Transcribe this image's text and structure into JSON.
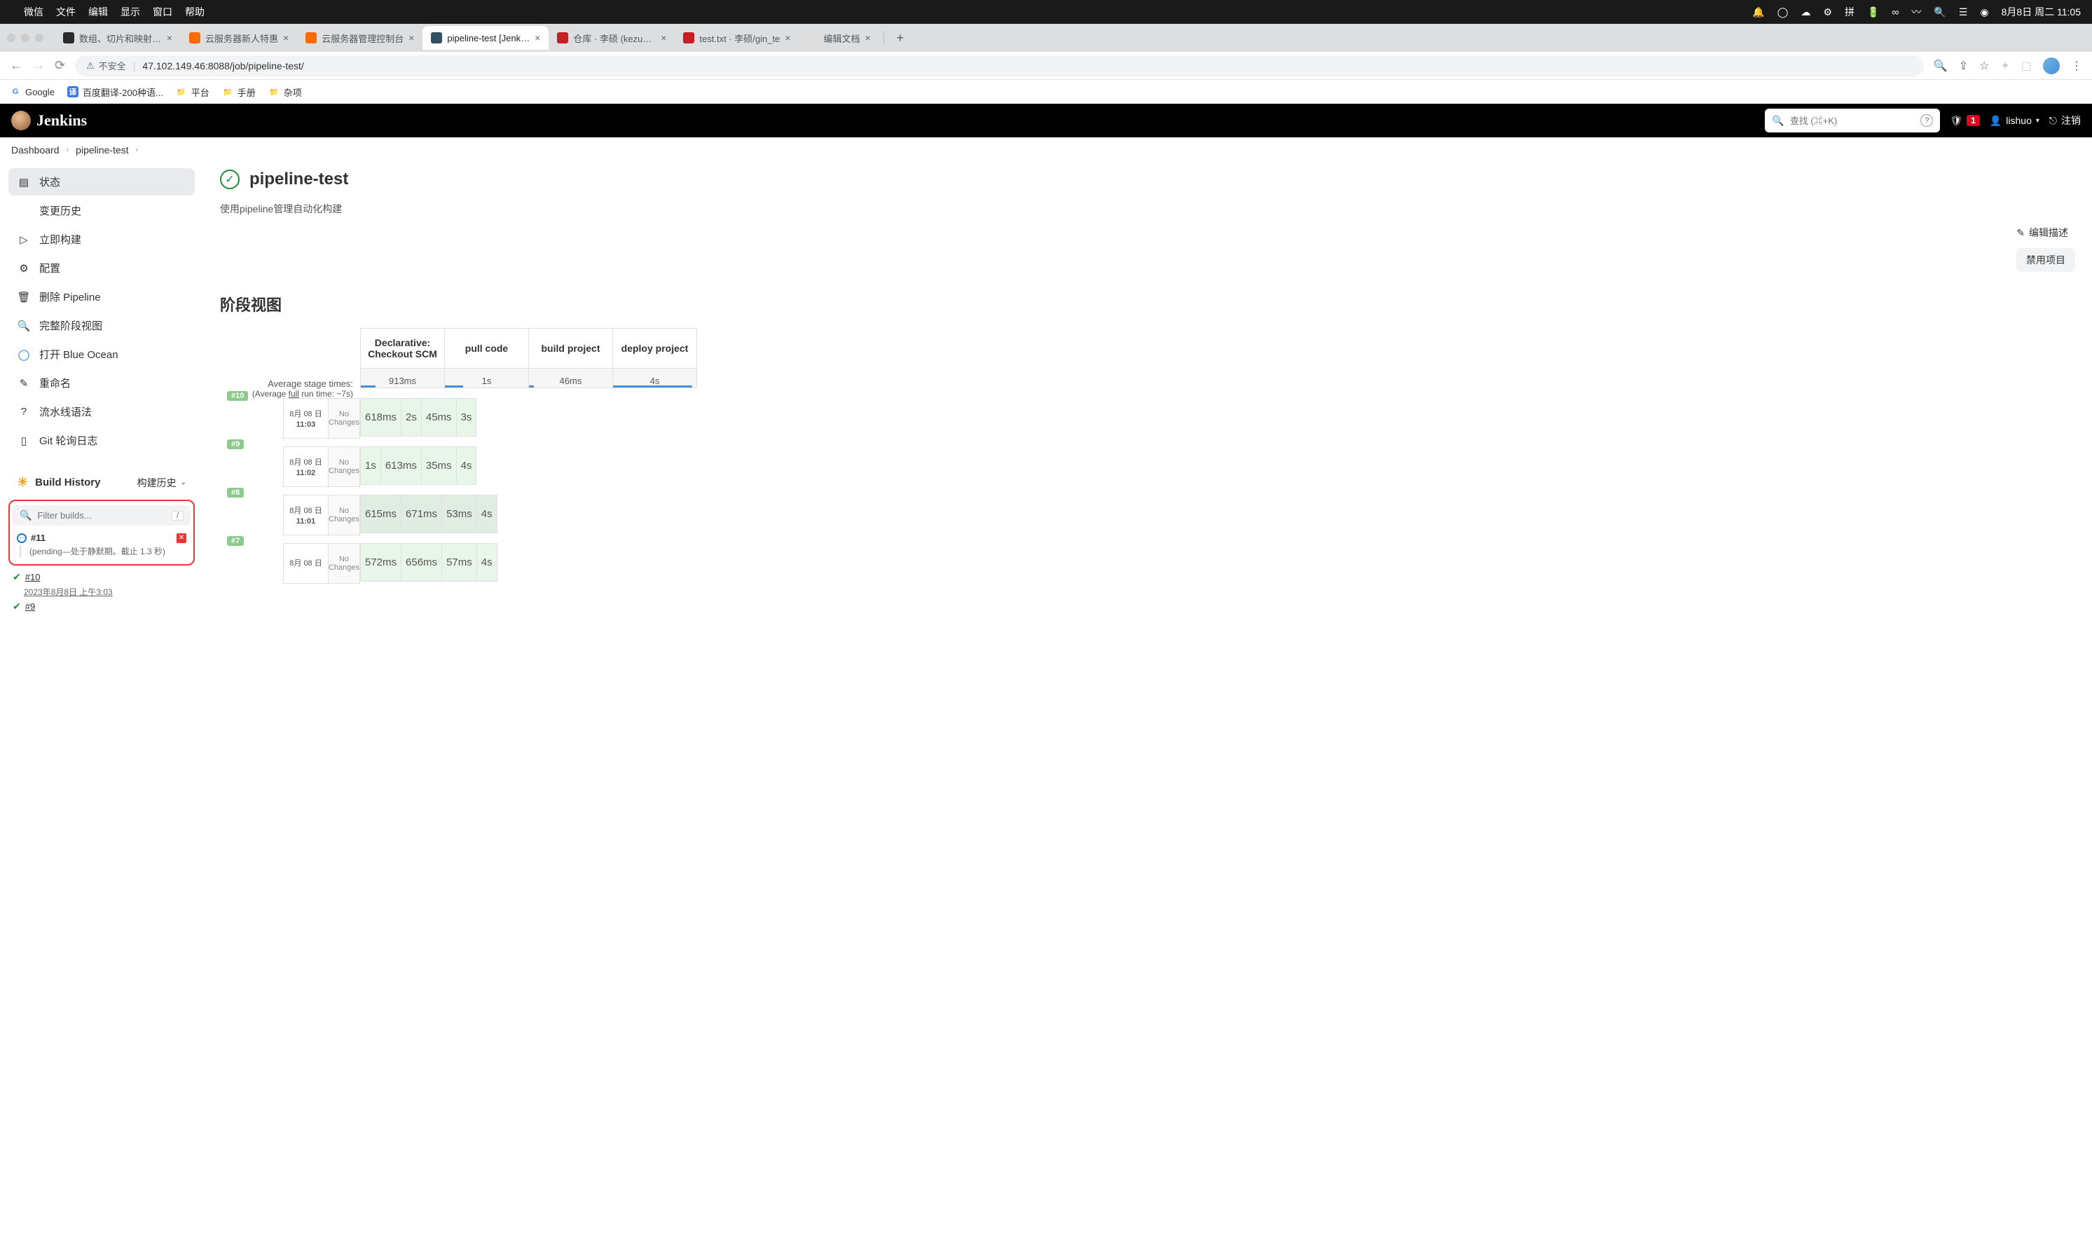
{
  "mac_menubar": {
    "app": "微信",
    "menus": [
      "文件",
      "编辑",
      "显示",
      "窗口",
      "帮助"
    ],
    "datetime": "8月8日 周二  11:05"
  },
  "browser": {
    "tabs": [
      {
        "label": "数组、切片和映射 -Go",
        "favicon_bg": "#2b2b2b"
      },
      {
        "label": "云服务器新人特惠",
        "favicon_bg": "#ff6a00"
      },
      {
        "label": "云服务器管理控制台",
        "favicon_bg": "#ff6a00"
      },
      {
        "label": "pipeline-test [Jenkins",
        "favicon_bg": "#335061",
        "active": true
      },
      {
        "label": "仓库 · 李硕 (kezuo) ·",
        "favicon_bg": "#c71d23"
      },
      {
        "label": "test.txt · 李硕/gin_te",
        "favicon_bg": "#c71d23"
      },
      {
        "label": "编辑文档",
        "favicon_bg": "#dddddd"
      }
    ],
    "address": {
      "insecure_label": "不安全",
      "url": "47.102.149.46:8088/job/pipeline-test/"
    },
    "bookmarks": [
      {
        "label": "Google",
        "icon": "G",
        "icon_bg": "#fff",
        "icon_color": "#4285f4"
      },
      {
        "label": "百度翻译-200种语...",
        "icon": "译",
        "icon_bg": "#3b7ae0",
        "icon_color": "#fff"
      },
      {
        "label": "平台",
        "icon": "📁"
      },
      {
        "label": "手册",
        "icon": "📁"
      },
      {
        "label": "杂项",
        "icon": "📁"
      }
    ]
  },
  "jenkins": {
    "logo": "Jenkins",
    "search_placeholder": "查找 (⌘+K)",
    "alert_count": "1",
    "user": "lishuo",
    "logout": "注销",
    "breadcrumb": [
      "Dashboard",
      "pipeline-test"
    ],
    "sidebar": [
      {
        "icon": "status",
        "label": "状态",
        "active": true
      },
      {
        "icon": "changes",
        "label": "变更历史"
      },
      {
        "icon": "build",
        "label": "立即构建"
      },
      {
        "icon": "config",
        "label": "配置"
      },
      {
        "icon": "delete",
        "label": "删除 Pipeline"
      },
      {
        "icon": "fullstage",
        "label": "完整阶段视图"
      },
      {
        "icon": "blueocean",
        "label": "打开 Blue Ocean"
      },
      {
        "icon": "rename",
        "label": "重命名"
      },
      {
        "icon": "syntax",
        "label": "流水线语法"
      },
      {
        "icon": "gitpoll",
        "label": "Git 轮询日志"
      }
    ],
    "build_history": {
      "title": "Build History",
      "subtitle": "构建历史",
      "filter_placeholder": "Filter builds...",
      "filter_kbd": "/",
      "pending": {
        "num": "#11",
        "text": "(pending—处于静默期。截止 1.3 秒)"
      },
      "builds": [
        {
          "num": "#10",
          "date": "2023年8月8日 上午3:03"
        },
        {
          "num": "#9"
        }
      ]
    },
    "page": {
      "title": "pipeline-test",
      "description": "使用pipeline管理自动化构建",
      "edit_desc": "编辑描述",
      "disable": "禁用项目",
      "section": "阶段视图",
      "stages": {
        "headers": [
          "Declarative: Checkout SCM",
          "pull code",
          "build project",
          "deploy project"
        ],
        "avg_label": "Average stage times:",
        "avg_sub_prefix": "(Average ",
        "avg_sub_link": "full",
        "avg_sub_suffix": " run time: ~7s)",
        "avg": [
          "913ms",
          "1s",
          "46ms",
          "4s"
        ],
        "avg_bar_pct": [
          18,
          22,
          6,
          95
        ],
        "rows": [
          {
            "badge": "#10",
            "date1": "8月 08 日",
            "time": "11:03",
            "changes": "No Changes",
            "cells": [
              "618ms",
              "2s",
              "45ms",
              "3s"
            ]
          },
          {
            "badge": "#9",
            "date1": "8月 08 日",
            "time": "11:02",
            "changes": "No Changes",
            "cells": [
              "1s",
              "613ms",
              "35ms",
              "4s"
            ]
          },
          {
            "badge": "#8",
            "date1": "8月 08 日",
            "time": "11:01",
            "changes": "No Changes",
            "cells": [
              "615ms",
              "671ms",
              "53ms",
              "4s"
            ],
            "dim": true
          },
          {
            "badge": "#7",
            "date1": "8月 08 日",
            "time": "",
            "changes": "No Changes",
            "cells": [
              "572ms",
              "656ms",
              "57ms",
              "4s"
            ]
          }
        ]
      }
    }
  }
}
